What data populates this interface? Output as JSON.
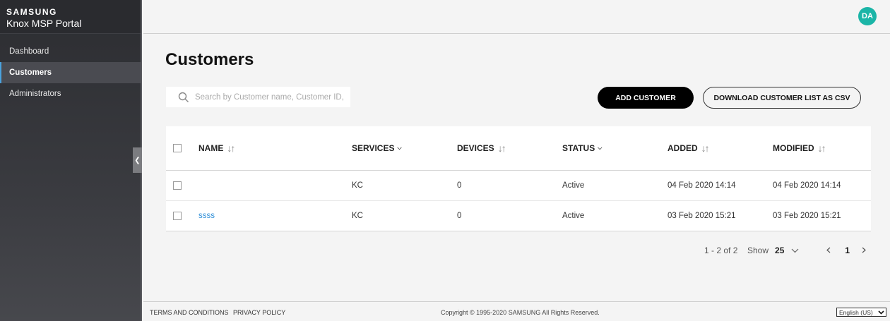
{
  "brand": {
    "top": "SAMSUNG",
    "bottom": "Knox MSP Portal"
  },
  "sidebar": {
    "items": [
      {
        "label": "Dashboard",
        "active": false
      },
      {
        "label": "Customers",
        "active": true
      },
      {
        "label": "Administrators",
        "active": false
      }
    ]
  },
  "user": {
    "initials": "DA",
    "avatar_color": "#1bb5a7"
  },
  "page": {
    "title": "Customers"
  },
  "search": {
    "placeholder": "Search by Customer name, Customer ID, Servi",
    "value": ""
  },
  "actions": {
    "add_label": "ADD CUSTOMER",
    "download_label": "DOWNLOAD CUSTOMER LIST AS CSV"
  },
  "table": {
    "headers": [
      "NAME",
      "SERVICES",
      "DEVICES",
      "STATUS",
      "ADDED",
      "MODIFIED"
    ],
    "rows": [
      {
        "name": "",
        "services": "KC",
        "devices": "0",
        "status": "Active",
        "added": "04 Feb 2020 14:14",
        "modified": "04 Feb 2020 14:14"
      },
      {
        "name": "ssss",
        "services": "KC",
        "devices": "0",
        "status": "Active",
        "added": "03 Feb 2020 15:21",
        "modified": "03 Feb 2020 15:21"
      }
    ]
  },
  "pagination": {
    "range": "1 - 2 of 2",
    "show_label": "Show",
    "page_size": "25",
    "current_page": "1"
  },
  "footer": {
    "terms": "TERMS AND CONDITIONS",
    "privacy": "PRIVACY POLICY",
    "copyright": "Copyright © 1995-2020 SAMSUNG All Rights Reserved.",
    "language": "English (US)"
  },
  "colors": {
    "accent_link": "#2f8fd8",
    "primary_button": "#000000"
  }
}
